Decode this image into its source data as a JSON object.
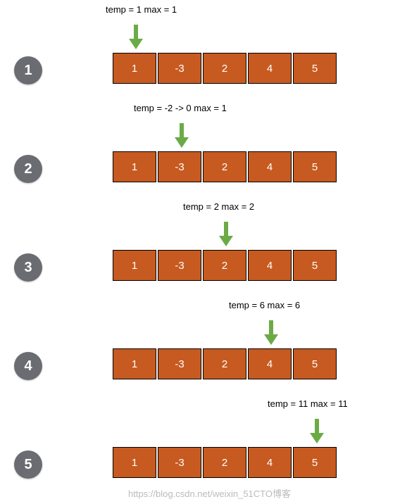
{
  "cells": [
    "1",
    "-3",
    "2",
    "4",
    "5"
  ],
  "steps": [
    {
      "num": "1",
      "label": "temp = 1   max = 1",
      "labelLeft": 150,
      "arrowLeft": 183,
      "arrayTop": 75,
      "labelTop": 6,
      "arrowTop": 35,
      "numTop": 80
    },
    {
      "num": "2",
      "label": "temp = -2 -> 0    max = 1",
      "labelLeft": 190,
      "arrowLeft": 248,
      "arrayTop": 75,
      "labelTop": 6,
      "arrowTop": 35,
      "numTop": 80
    },
    {
      "num": "3",
      "label": "temp = 2   max = 2",
      "labelLeft": 260,
      "arrowLeft": 311,
      "arrayTop": 75,
      "labelTop": 6,
      "arrowTop": 35,
      "numTop": 80
    },
    {
      "num": "4",
      "label": "temp = 6   max = 6",
      "labelLeft": 325,
      "arrowLeft": 375,
      "arrayTop": 75,
      "labelTop": 6,
      "arrowTop": 35,
      "numTop": 80
    },
    {
      "num": "5",
      "label": "temp = 11   max = 11",
      "labelLeft": 380,
      "arrowLeft": 440,
      "arrayTop": 75,
      "labelTop": 6,
      "arrowTop": 35,
      "numTop": 80
    }
  ],
  "watermark": "https://blog.csdn.net/weixin_51CTO博客"
}
